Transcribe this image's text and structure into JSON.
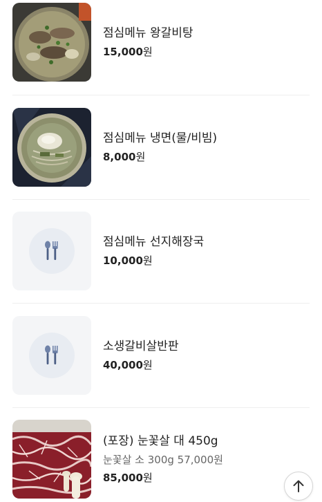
{
  "menu_items": [
    {
      "name": "점심메뉴 왕갈비탕",
      "price": "15,000",
      "unit": "원",
      "image": "galbitang-photo"
    },
    {
      "name": "점심메뉴 냉면(물/비빔)",
      "price": "8,000",
      "unit": "원",
      "image": "naengmyeon-photo"
    },
    {
      "name": "점심메뉴 선지해장국",
      "price": "10,000",
      "unit": "원",
      "image": "utensils-icon"
    },
    {
      "name": "소생갈비살반판",
      "price": "40,000",
      "unit": "원",
      "image": "utensils-icon"
    },
    {
      "name": "(포장) 눈꽃살 대 450g",
      "description": "눈꽃살 소 300g 57,000원",
      "price": "85,000",
      "unit": "원",
      "image": "marbled-beef-photo"
    }
  ],
  "scroll_top_button": {
    "icon": "arrow-up-icon"
  },
  "colors": {
    "text_primary": "#222222",
    "text_secondary": "#666666",
    "placeholder_bg": "#f4f5f7",
    "placeholder_circle": "#e8ecf2",
    "utensil_icon": "#6f82a8",
    "divider": "#eeeeee"
  }
}
